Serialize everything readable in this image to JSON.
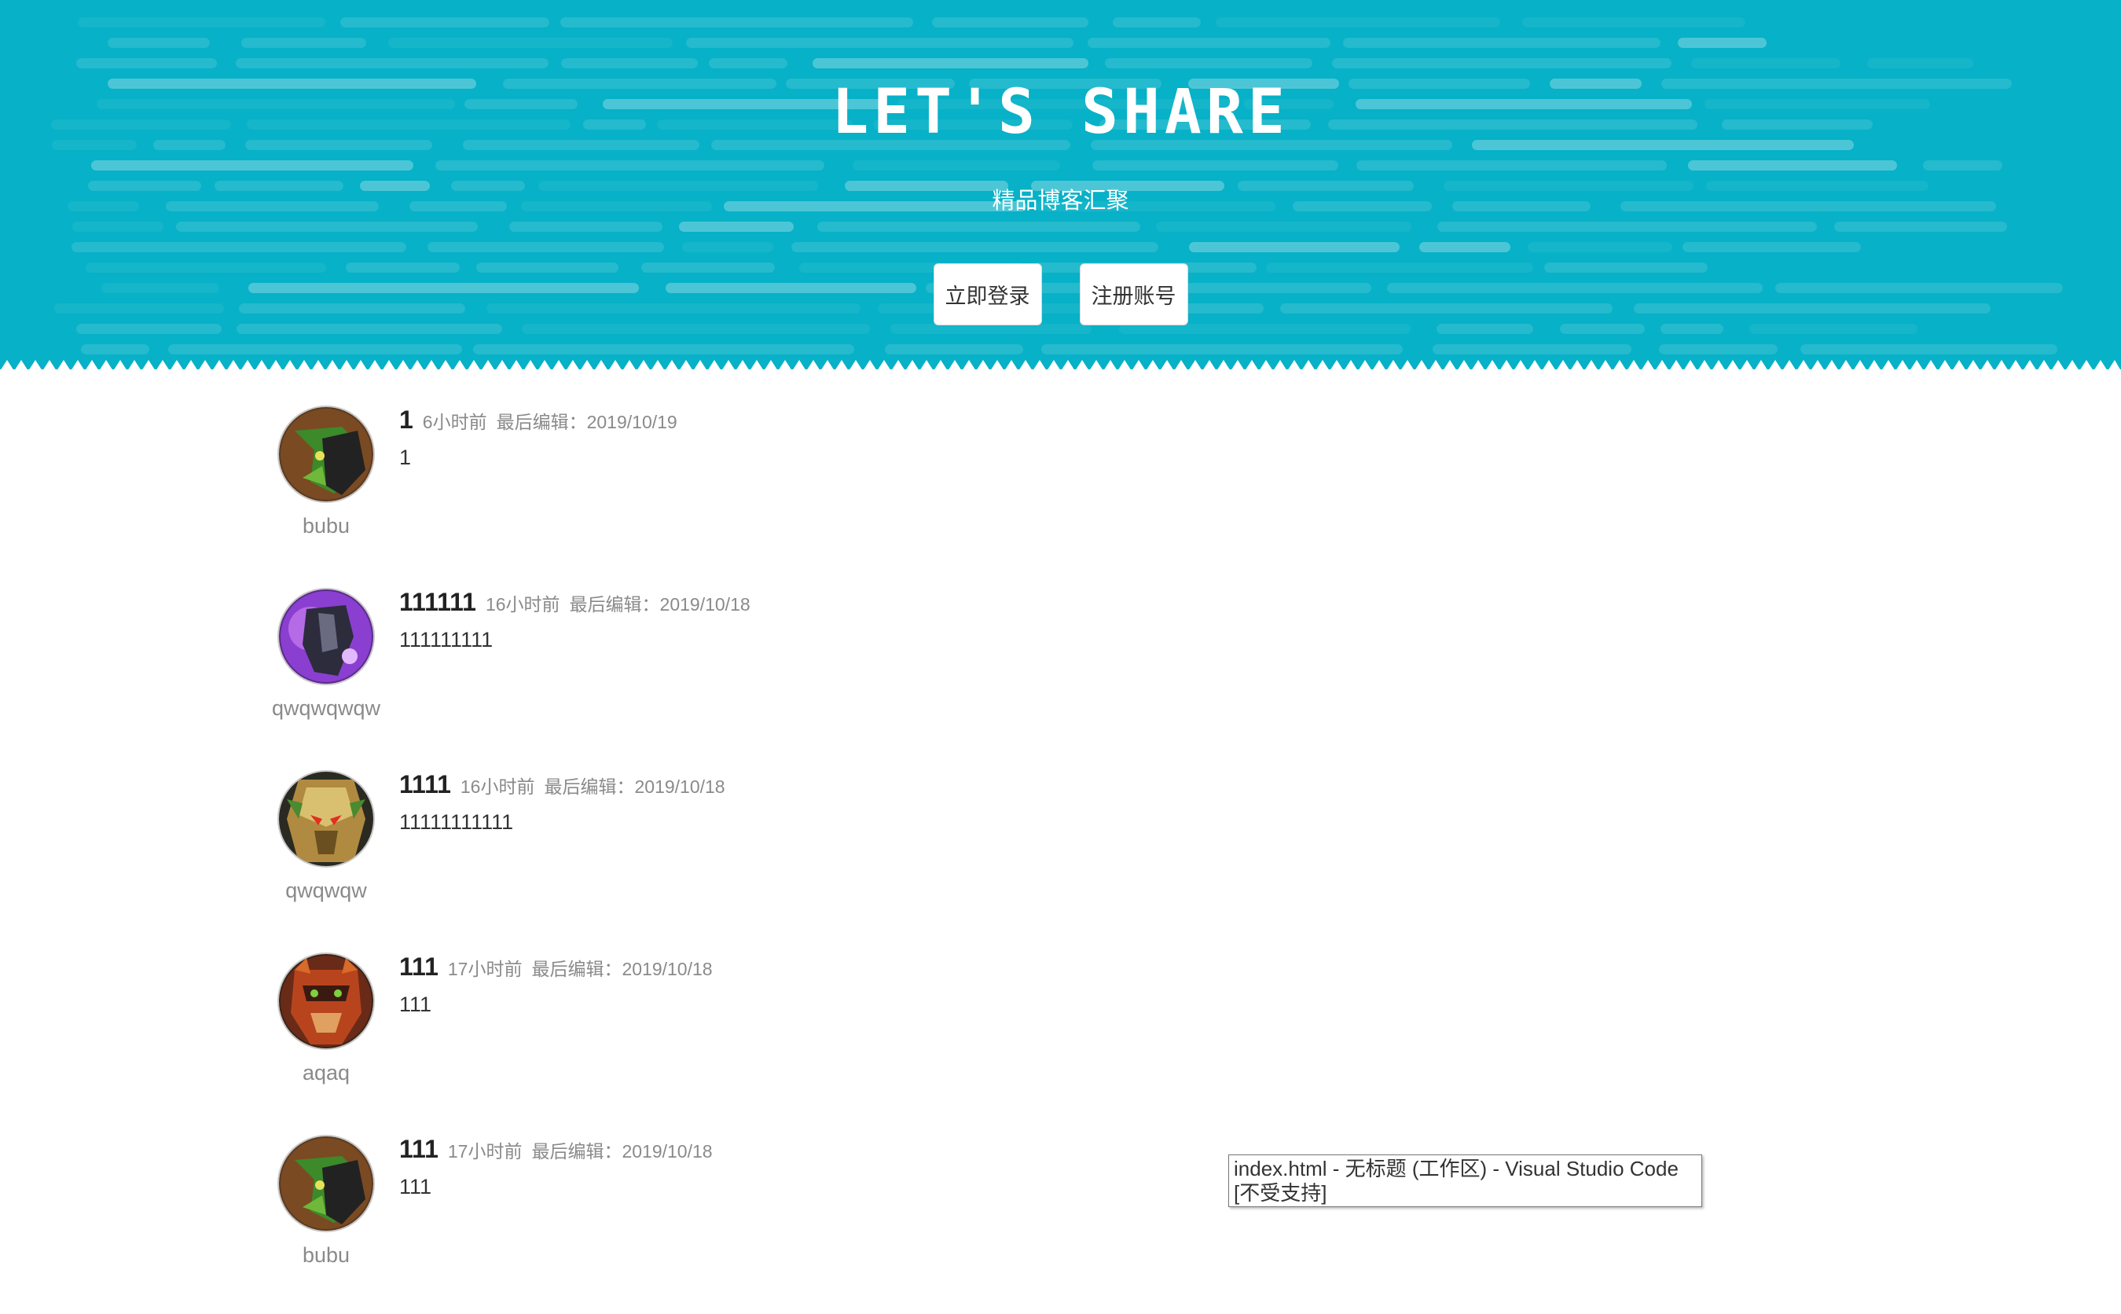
{
  "hero": {
    "title": "LET'S SHARE",
    "subtitle": "精品博客汇聚",
    "login_button": "立即登录",
    "register_button": "注册账号",
    "background_color": "#07b1c7"
  },
  "posts": [
    {
      "author": "bubu",
      "avatar_icon": "green-orc-avatar-icon",
      "title": "1",
      "time_ago": "6小时前",
      "last_edit": "最后编辑：2019/10/19",
      "content": "1"
    },
    {
      "author": "qwqwqwqw",
      "avatar_icon": "purple-warrior-avatar-icon",
      "title": "111111",
      "time_ago": "16小时前",
      "last_edit": "最后编辑：2019/10/18",
      "content": "111111111"
    },
    {
      "author": "qwqwqw",
      "avatar_icon": "gold-helmet-avatar-icon",
      "title": "1111",
      "time_ago": "16小时前",
      "last_edit": "最后编辑：2019/10/18",
      "content": "11111111111"
    },
    {
      "author": "aqaq",
      "avatar_icon": "red-beast-avatar-icon",
      "title": "111",
      "time_ago": "17小时前",
      "last_edit": "最后编辑：2019/10/18",
      "content": "111"
    },
    {
      "author": "bubu",
      "avatar_icon": "green-orc-avatar-icon",
      "title": "111",
      "time_ago": "17小时前",
      "last_edit": "最后编辑：2019/10/18",
      "content": "111"
    }
  ],
  "tooltip": {
    "text": "index.html - 无标题 (工作区) - Visual Studio Code [不受支持]"
  }
}
